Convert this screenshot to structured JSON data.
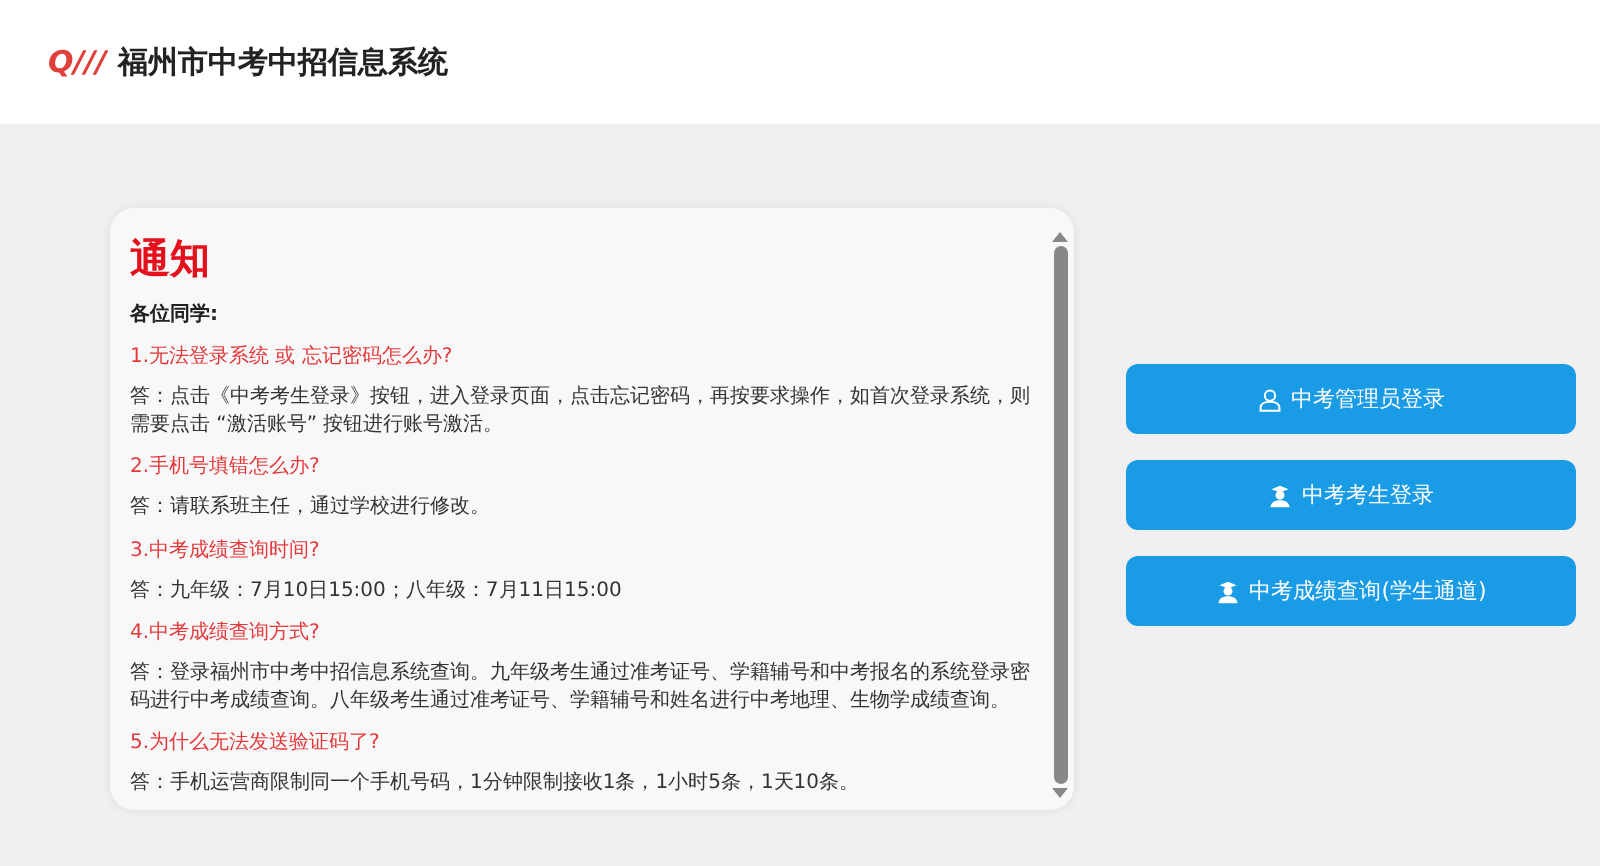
{
  "header": {
    "logo": "Q///",
    "title": "福州市中考中招信息系统"
  },
  "notice": {
    "title": "通知",
    "greeting": "各位同学:",
    "items": [
      {
        "question": "1.无法登录系统 或 忘记密码怎么办?",
        "answer": "答：点击《中考考生登录》按钮，进入登录页面，点击忘记密码，再按要求操作，如首次登录系统，则需要点击 “激活账号” 按钮进行账号激活。"
      },
      {
        "question": "2.手机号填错怎么办?",
        "answer": "答：请联系班主任，通过学校进行修改。"
      },
      {
        "question": "3.中考成绩查询时间?",
        "answer": "答：九年级：7月10日15:00；八年级：7月11日15:00"
      },
      {
        "question": "4.中考成绩查询方式?",
        "answer": "答：登录福州市中考中招信息系统查询。九年级考生通过准考证号、学籍辅号和中考报名的系统登录密码进行中考成绩查询。八年级考生通过准考证号、学籍辅号和姓名进行中考地理、生物学成绩查询。"
      },
      {
        "question": "5.为什么无法发送验证码了?",
        "answer": "答：手机运营商限制同一个手机号码，1分钟限制接收1条，1小时5条，1天10条。"
      }
    ]
  },
  "buttons": [
    {
      "kind": "admin",
      "label": "中考管理员登录"
    },
    {
      "kind": "student",
      "label": "中考考生登录"
    },
    {
      "kind": "student",
      "label": "中考成绩查询(学生通道)"
    }
  ]
}
